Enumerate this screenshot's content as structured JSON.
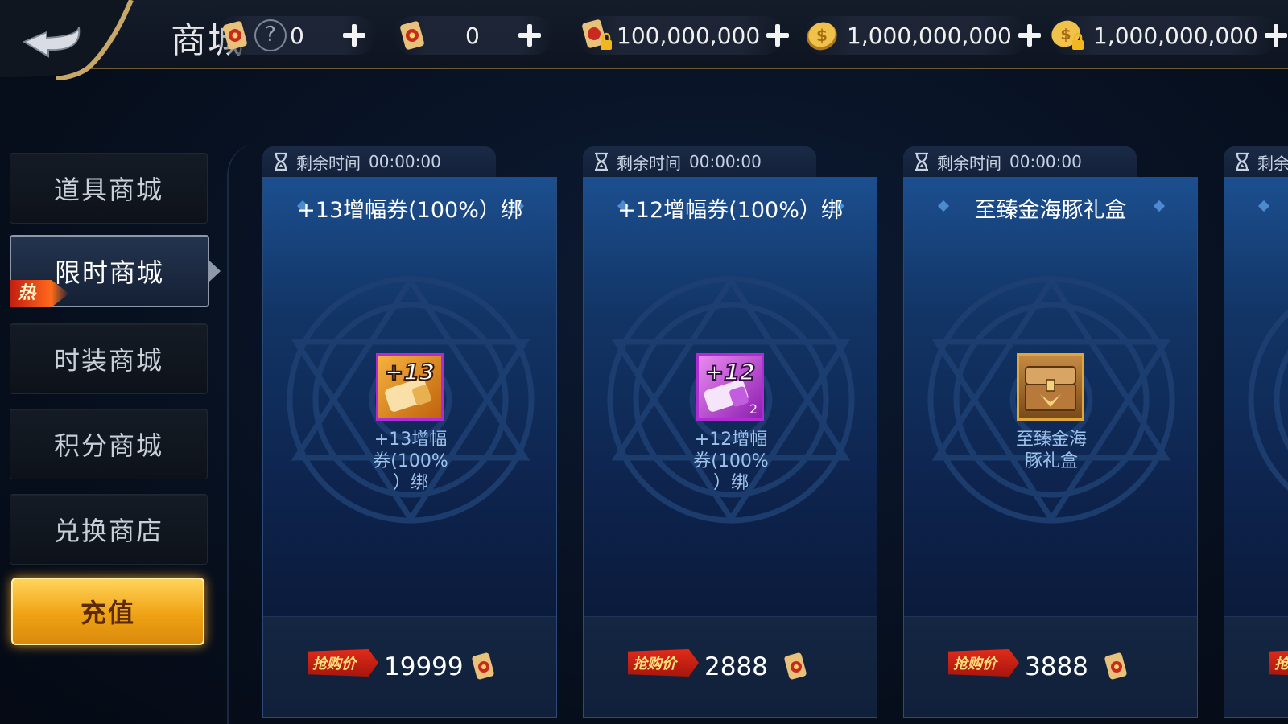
{
  "header": {
    "title": "商城",
    "help_symbol": "?",
    "currencies": [
      {
        "icon": "red-scroll-icon",
        "value": "0"
      },
      {
        "icon": "red-scroll-icon",
        "value": "0"
      },
      {
        "icon": "locked-scroll-icon",
        "value": "100,000,000"
      },
      {
        "icon": "gold-coin-icon",
        "value": "1,000,000,000"
      },
      {
        "icon": "locked-gold-coin-icon",
        "value": "1,000,000,000"
      }
    ]
  },
  "sidebar": {
    "items": [
      {
        "label": "道具商城"
      },
      {
        "label": "限时商城",
        "active": true,
        "badge": "热"
      },
      {
        "label": "时装商城"
      },
      {
        "label": "积分商城"
      },
      {
        "label": "兑换商店"
      }
    ],
    "recharge_label": "充值"
  },
  "cards": [
    {
      "timer_label": "剩余时间",
      "timer_value": "00:00:00",
      "title": "+13增幅券(100%）绑",
      "icon": "plus13-ticket-icon",
      "icon_text": "+13",
      "item_name_lines": [
        "+13增幅",
        "券(100%",
        "）绑"
      ],
      "price_tag": "抢购价",
      "price": "19999"
    },
    {
      "timer_label": "剩余时间",
      "timer_value": "00:00:00",
      "title": "+12增幅券(100%）绑",
      "icon": "plus12-ticket-icon",
      "icon_text": "+12",
      "icon_count": "2",
      "item_name_lines": [
        "+12增幅",
        "券(100%",
        "）绑"
      ],
      "price_tag": "抢购价",
      "price": "2888"
    },
    {
      "timer_label": "剩余时间",
      "timer_value": "00:00:00",
      "title": "至臻金海豚礼盒",
      "icon": "gold-chest-icon",
      "item_name_lines": [
        "至臻金海",
        "豚礼盒"
      ],
      "price_tag": "抢购价",
      "price": "3888"
    },
    {
      "timer_label": "剩余",
      "price_tag": "抢"
    }
  ],
  "colors": {
    "accent_gold": "#f0a214",
    "price_red": "#c21d10",
    "card_blue": "#123566",
    "item_name_blue": "#9ec3ea"
  }
}
